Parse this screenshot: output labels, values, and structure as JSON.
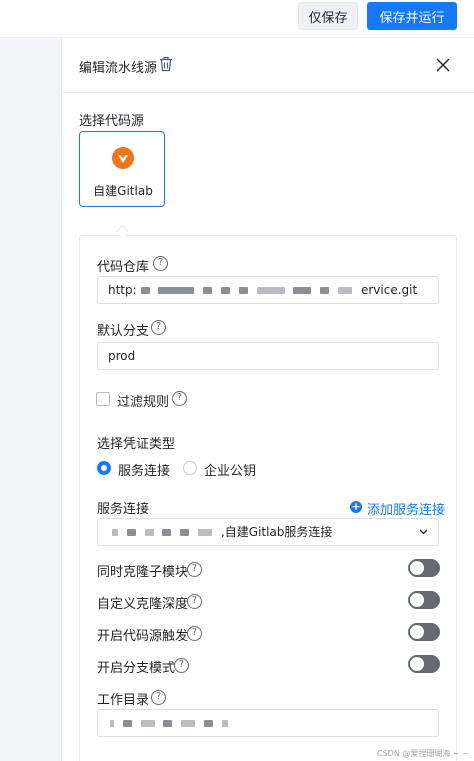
{
  "topbar": {
    "save_label": "仅保存",
    "save_run_label": "保存并运行"
  },
  "panel": {
    "title": "编辑流水线源",
    "source_section_label": "选择代码源",
    "source_card_label": "自建Gitlab"
  },
  "form": {
    "repo": {
      "label": "代码仓库",
      "value_prefix": "http:",
      "value_suffix": "ervice.git"
    },
    "default_branch": {
      "label": "默认分支",
      "value": "prod"
    },
    "filter_rules": {
      "label": "过滤规则",
      "checked": false
    },
    "credential_type": {
      "label": "选择凭证类型",
      "options": [
        {
          "label": "服务连接",
          "selected": true
        },
        {
          "label": "企业公钥",
          "selected": false
        }
      ]
    },
    "service_connection": {
      "label": "服务连接",
      "add_label": "添加服务连接",
      "value_suffix": ",自建Gitlab服务连接"
    },
    "toggles": [
      {
        "label": "同时克隆子模块",
        "on": false
      },
      {
        "label": "自定义克隆深度",
        "on": false
      },
      {
        "label": "开启代码源触发",
        "on": false
      },
      {
        "label": "开启分支模式",
        "on": false
      }
    ],
    "work_dir": {
      "label": "工作目录"
    }
  },
  "watermark": "CSDN @爱捏珊瑚海 ~ ~",
  "colors": {
    "primary": "#1677ff",
    "gitlab_orange": "#f0741c",
    "toggle_off": "#646a73"
  }
}
